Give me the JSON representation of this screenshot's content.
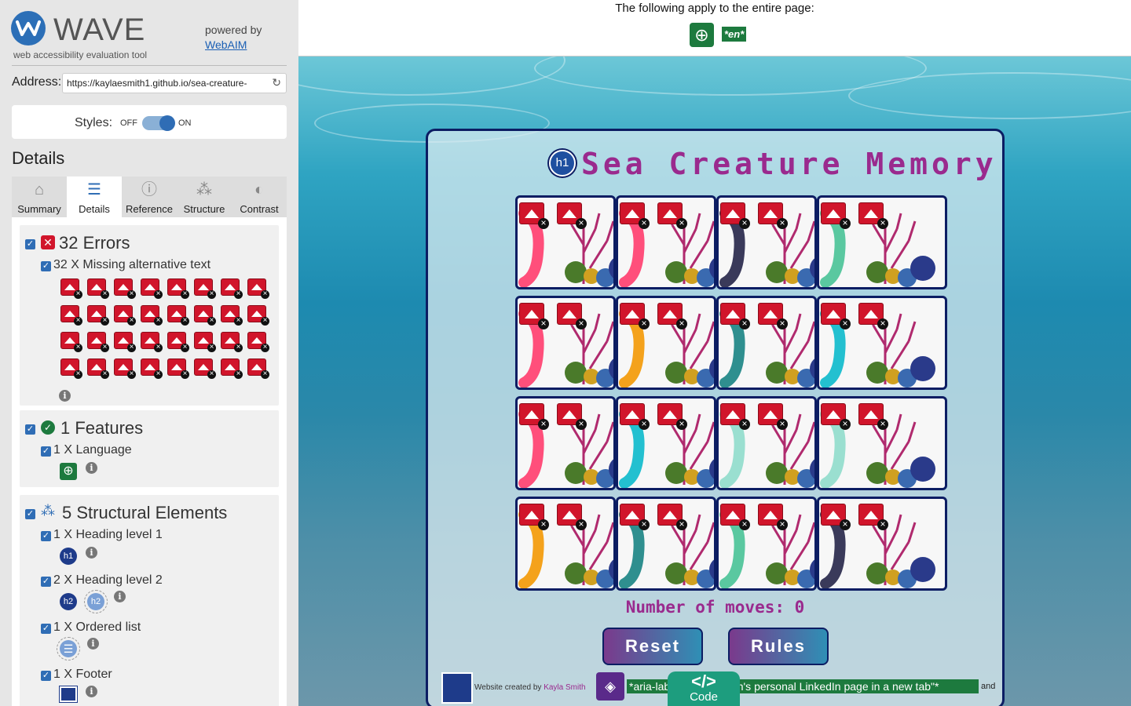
{
  "sidebar": {
    "brand": "WAVE",
    "tagline": "web accessibility evaluation tool",
    "powered_by": "powered by",
    "webaim_link": "WebAIM",
    "address_label": "Address:",
    "address_value": "https://kaylaesmith1.github.io/sea-creature-",
    "styles_label": "Styles:",
    "styles_off": "OFF",
    "styles_on": "ON",
    "details_title": "Details",
    "tabs": [
      {
        "label": "Summary",
        "icon": "home-icon"
      },
      {
        "label": "Details",
        "icon": "list-icon"
      },
      {
        "label": "Reference",
        "icon": "info-icon"
      },
      {
        "label": "Structure",
        "icon": "hierarchy-icon"
      },
      {
        "label": "Contrast",
        "icon": "contrast-icon"
      }
    ],
    "errors": {
      "heading": "32 Errors",
      "item": "32 X Missing alternative text",
      "count": 32
    },
    "features": {
      "heading": "1 Features",
      "item": "1 X Language"
    },
    "structure": {
      "heading": "5 Structural Elements",
      "items": [
        "1 X Heading level 1",
        "2 X Heading level 2",
        "1 X Ordered list",
        "1 X Footer"
      ],
      "h1_badge": "h1",
      "h2_badge": "h2"
    }
  },
  "topbar": {
    "apply_text": "The following apply to the entire page:",
    "lang_badge": "*en*"
  },
  "game": {
    "title": "Sea Creature Memory",
    "h1_badge": "h1",
    "moves": "Number of moves: 0",
    "reset_label": "Reset",
    "rules_label": "Rules",
    "footer_text": "Website created by",
    "footer_author": "Kayla Smith",
    "aria_label_text": "*aria-label: Kayla Smith's personal LinkedIn page in a new tab\"*",
    "and_text": "and",
    "code_button": "Code",
    "code_icon": "</>"
  },
  "colors": {
    "accent": "#2f6db5",
    "error": "#d1152b",
    "feature": "#1d7a3e",
    "title": "#9a2a8e"
  }
}
